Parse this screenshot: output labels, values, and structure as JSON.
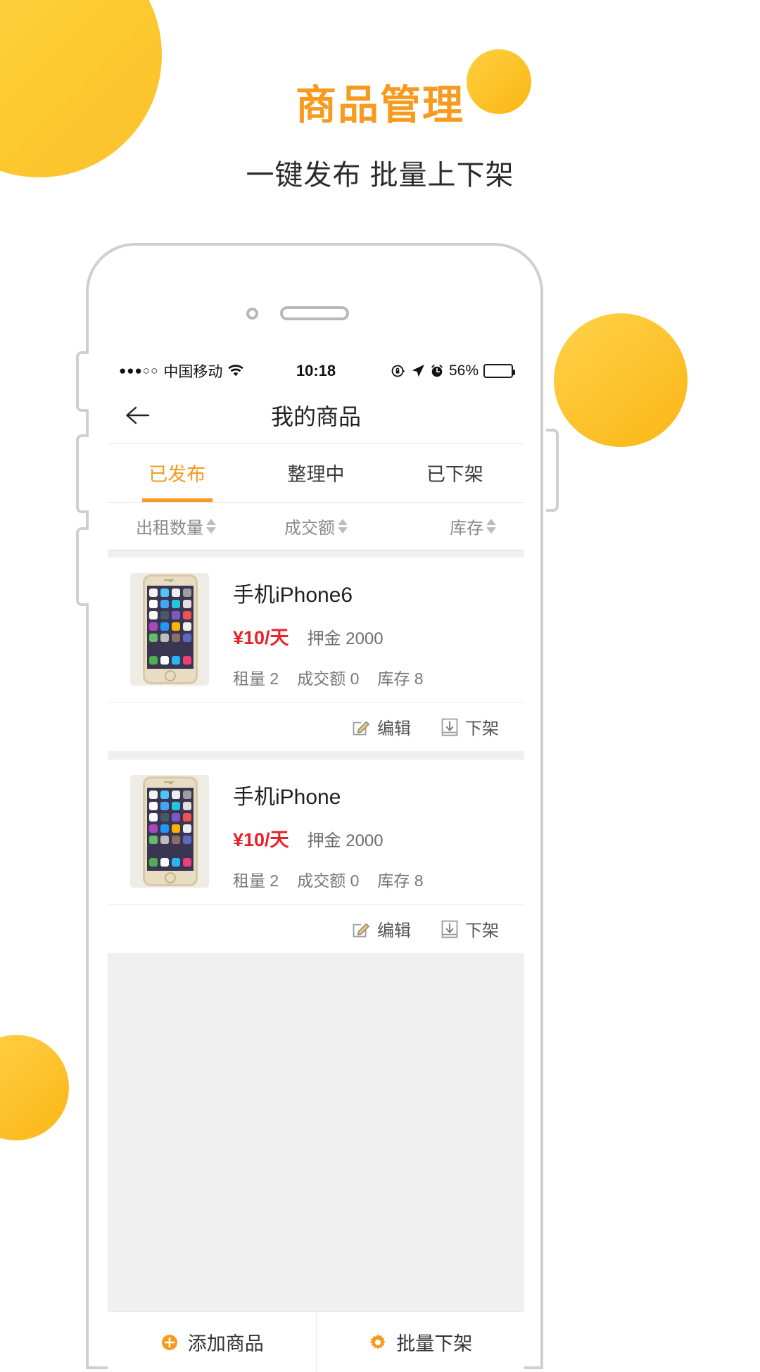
{
  "hero": {
    "title": "商品管理",
    "subtitle": "一键发布 批量上下架"
  },
  "colors": {
    "accent_orange": "#F79A1F",
    "blob_yellow": "#FBC02D",
    "price_red": "#E8222A",
    "screen_bg": "#F0F0F0"
  },
  "phone": {
    "status_bar": {
      "signal_dots": "●●●○○",
      "carrier": "中国移动",
      "wifi_icon": "wifi-icon",
      "time": "10:18",
      "rotation_lock_icon": "rotation-lock-icon",
      "location_icon": "location-arrow-icon",
      "alarm_icon": "alarm-clock-icon",
      "battery_percent": "56%",
      "battery_level": 56
    },
    "nav": {
      "back_icon": "back-arrow-icon",
      "title": "我的商品"
    },
    "tabs": [
      {
        "label": "已发布",
        "active": true
      },
      {
        "label": "整理中",
        "active": false
      },
      {
        "label": "已下架",
        "active": false
      }
    ],
    "sort": [
      {
        "label": "出租数量",
        "icon": "sort-arrows-icon"
      },
      {
        "label": "成交额",
        "icon": "sort-arrows-icon"
      },
      {
        "label": "库存",
        "icon": "sort-arrows-icon"
      }
    ],
    "products": [
      {
        "thumb_icon": "iphone-gold-photo",
        "name": "手机iPhone6",
        "price": "¥10/天",
        "deposit": "押金 2000",
        "stats": [
          "租量 2",
          "成交额 0",
          "库存 8"
        ],
        "actions": [
          {
            "label": "编辑",
            "icon": "pencil-edit-icon"
          },
          {
            "label": "下架",
            "icon": "unlist-arrow-icon"
          }
        ]
      },
      {
        "thumb_icon": "iphone-gold-photo",
        "name": "手机iPhone",
        "price": "¥10/天",
        "deposit": "押金 2000",
        "stats": [
          "租量 2",
          "成交额 0",
          "库存 8"
        ],
        "actions": [
          {
            "label": "编辑",
            "icon": "pencil-edit-icon"
          },
          {
            "label": "下架",
            "icon": "unlist-arrow-icon"
          }
        ]
      }
    ],
    "bottom_bar": [
      {
        "label": "添加商品",
        "icon": "plus-circle-icon"
      },
      {
        "label": "批量下架",
        "icon": "gear-icon"
      }
    ]
  }
}
